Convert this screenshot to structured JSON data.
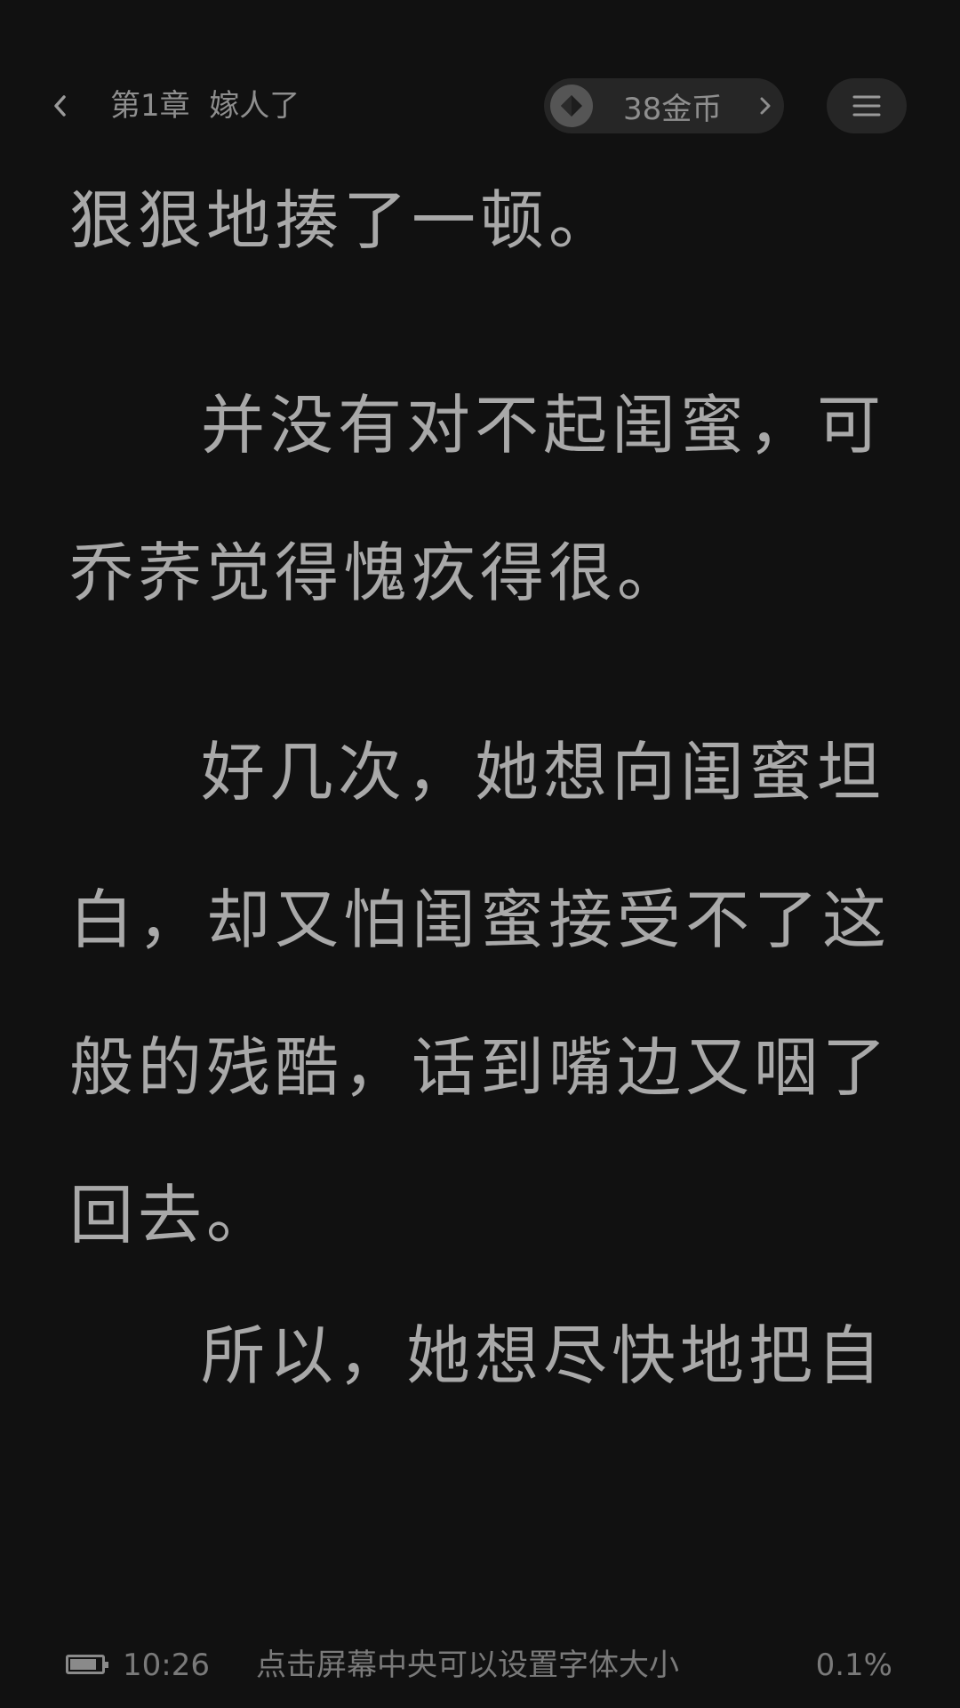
{
  "header": {
    "chapter_title": "第1章  嫁人了",
    "coins_label": "38金币",
    "back_icon": "chevron-left-icon",
    "coin_icon": "coin-icon",
    "menu_icon": "hamburger-menu-icon"
  },
  "content": {
    "lines": [
      "狠狠地揍了一顿。",
      "并没有对不起闺蜜，可",
      "乔荞觉得愧疚得很。",
      "好几次，她想向闺蜜坦",
      "白，却又怕闺蜜接受不了这",
      "般的残酷，话到嘴边又咽了",
      "回去。",
      "所以，她想尽快地把自"
    ]
  },
  "footer": {
    "time": "10:26",
    "hint": "点击屏幕中央可以设置字体大小",
    "progress": "0.1%",
    "battery_level": 0.85
  },
  "colors": {
    "background": "#111111",
    "text": "#a9a9a9",
    "pill": "#262626"
  }
}
